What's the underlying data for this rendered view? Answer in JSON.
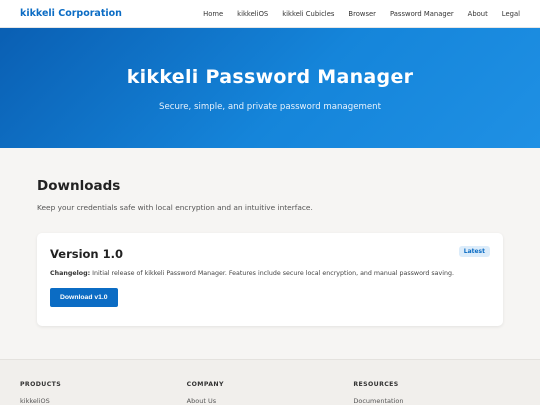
{
  "nav": {
    "brand": "kikkeli Corporation",
    "links": [
      "Home",
      "kikkeliOS",
      "kikkeli Cubicles",
      "Browser",
      "Password Manager",
      "About",
      "Legal"
    ]
  },
  "hero": {
    "title": "kikkeli Password Manager",
    "subtitle": "Secure, simple, and private password management"
  },
  "downloads": {
    "heading": "Downloads",
    "subtitle": "Keep your credentials safe with local encryption and an intuitive interface.",
    "card": {
      "version": "Version 1.0",
      "badge": "Latest",
      "changelog_label": "Changelog:",
      "changelog_text": " Initial release of kikkeli Password Manager. Features include secure local encryption, and manual password saving.",
      "button": "Download v1.0"
    }
  },
  "footer": {
    "columns": [
      {
        "title": "PRODUCTS",
        "first_link": "kikkeliOS"
      },
      {
        "title": "COMPANY",
        "first_link": "About Us"
      },
      {
        "title": "RESOURCES",
        "first_link": "Documentation"
      }
    ]
  },
  "colors": {
    "accent": "#0b6cc4",
    "hero_start": "#0a5fb3",
    "hero_end": "#1f90e4"
  }
}
